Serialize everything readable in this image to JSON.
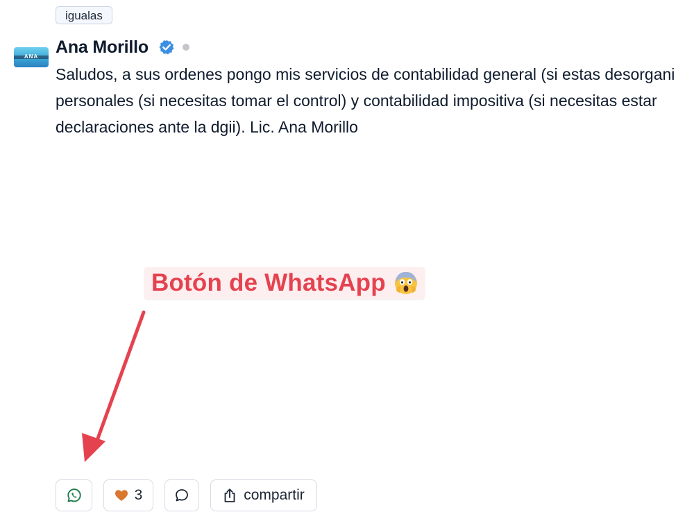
{
  "post": {
    "tag": "igualas",
    "avatar_initials": "ANA",
    "author": {
      "name": "Ana Morillo",
      "verified": true,
      "presence": "offline"
    },
    "body_lines": [
      "Saludos, a sus ordenes pongo mis servicios de contabilidad general (si estas desorgani",
      "personales (si necesitas tomar el control) y contabilidad impositiva (si necesitas estar",
      "declaraciones ante la dgii). Lic. Ana Morillo"
    ]
  },
  "annotation": {
    "label": "Botón de WhatsApp",
    "emoji": "face-screaming-in-fear-icon",
    "color": "#e5424f"
  },
  "actions": {
    "whatsapp_icon": "whatsapp-icon",
    "like_icon": "heart-icon",
    "like_count": "3",
    "comment_icon": "comment-bubble-icon",
    "share_icon": "share-icon",
    "share_label": "compartir"
  },
  "colors": {
    "whatsapp_green": "#1f7a4a",
    "heart_orange": "#d9772f",
    "verified_blue": "#3b8fe3"
  }
}
